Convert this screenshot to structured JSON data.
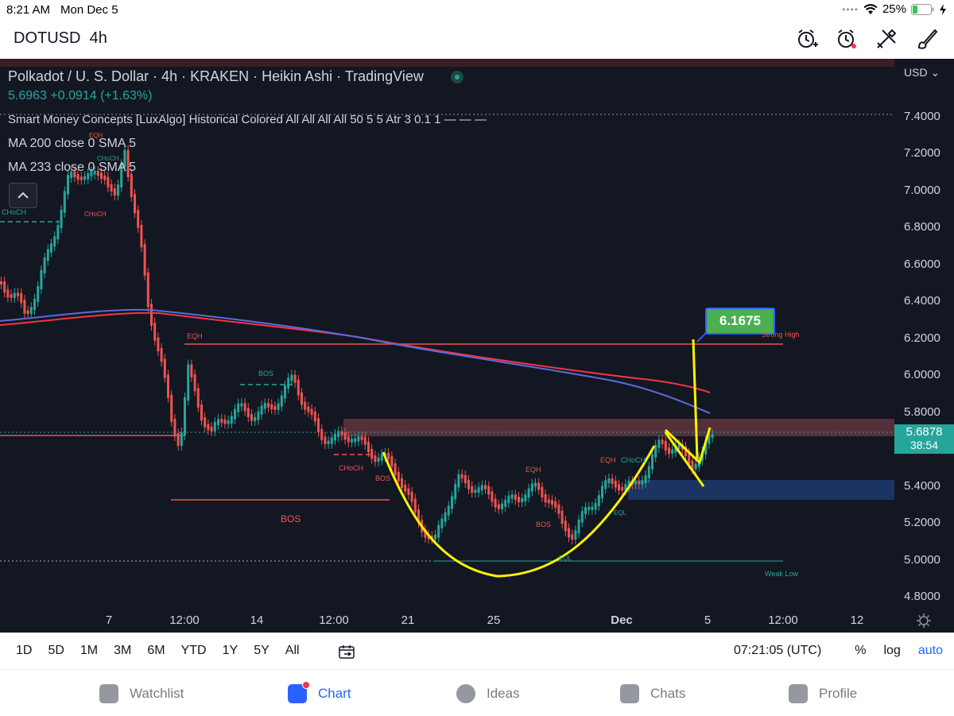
{
  "status": {
    "time": "8:21 AM",
    "date": "Mon Dec 5",
    "battery": "25%"
  },
  "header": {
    "symbol": "DOTUSD",
    "interval": "4h"
  },
  "legend": {
    "title": "Polkadot / U. S. Dollar · 4h · KRAKEN · Heikin Ashi · TradingView",
    "price_change": "5.6963  +0.0914 (+1.63%)",
    "indicator1": "Smart Money Concepts [LuxAlgo] Historical Colored All All All All 50 5 5 Atr 3 0.1 1 — — —",
    "indicator2": "MA 200 close 0 SMA 5",
    "indicator3": "MA 233 close 0 SMA 5"
  },
  "axis": {
    "currency": "USD",
    "prices": [
      "7.4000",
      "7.2000",
      "7.0000",
      "6.8000",
      "6.6000",
      "6.4000",
      "6.2000",
      "6.0000",
      "5.8000",
      "5.6000",
      "5.4000",
      "5.2000",
      "5.0000",
      "4.8000"
    ],
    "dates": [
      "7",
      "12:00",
      "14",
      "12:00",
      "21",
      "25",
      "Dec",
      "5",
      "12:00",
      "12"
    ],
    "current_price": "5.6878",
    "countdown": "38:54"
  },
  "annotations": {
    "target": "6.1675",
    "strong_high": "Strong High",
    "weak_low": "Weak Low",
    "labels": [
      "CHoCH",
      "EQH",
      "CHoCH",
      "CHoCH",
      "EQH",
      "BOS",
      "CHoCH",
      "BOS",
      "BOS",
      "EQH",
      "BOS",
      "EQL",
      "EQH",
      "CHoCH",
      "EQL"
    ]
  },
  "bottombar": {
    "ranges": [
      "1D",
      "5D",
      "1M",
      "3M",
      "6M",
      "YTD",
      "1Y",
      "5Y",
      "All"
    ],
    "clock": "07:21:05 (UTC)",
    "pct": "%",
    "log": "log",
    "auto": "auto"
  },
  "nav": {
    "watchlist": "Watchlist",
    "chart": "Chart",
    "ideas": "Ideas",
    "chats": "Chats",
    "profile": "Profile"
  },
  "colors": {
    "up": "#26a69a",
    "down": "#ef5350",
    "ma200": "#f23645",
    "ma233": "#5b6bdc",
    "curve": "#fff200",
    "accent": "#2962ff"
  }
}
